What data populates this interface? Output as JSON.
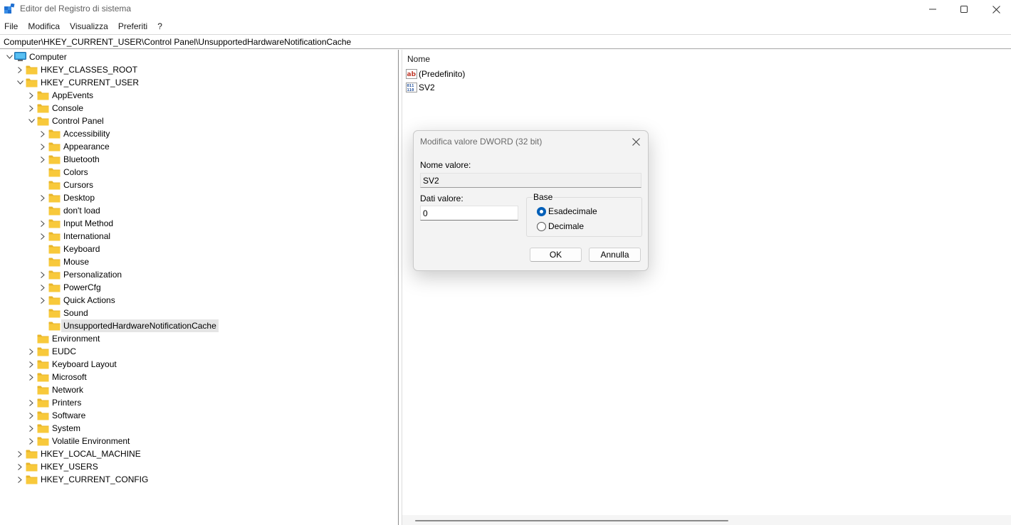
{
  "window": {
    "title": "Editor del Registro di sistema",
    "icon": "regedit-icon",
    "controls": [
      "minimize-icon",
      "maximize-icon",
      "close-icon"
    ]
  },
  "menu": {
    "items": [
      {
        "label": "File"
      },
      {
        "label": "Modifica"
      },
      {
        "label": "Visualizza"
      },
      {
        "label": "Preferiti"
      },
      {
        "label": "?"
      }
    ]
  },
  "address": {
    "path": "Computer\\HKEY_CURRENT_USER\\Control Panel\\UnsupportedHardwareNotificationCache"
  },
  "tree": {
    "items": [
      {
        "label": "Computer",
        "level": 0,
        "chevron": "down",
        "icon": "computer-icon"
      },
      {
        "label": "HKEY_CLASSES_ROOT",
        "level": 1,
        "chevron": "right"
      },
      {
        "label": "HKEY_CURRENT_USER",
        "level": 1,
        "chevron": "down"
      },
      {
        "label": "AppEvents",
        "level": 2,
        "chevron": "right"
      },
      {
        "label": "Console",
        "level": 2,
        "chevron": "right"
      },
      {
        "label": "Control Panel",
        "level": 2,
        "chevron": "down"
      },
      {
        "label": "Accessibility",
        "level": 3,
        "chevron": "right"
      },
      {
        "label": "Appearance",
        "level": 3,
        "chevron": "right"
      },
      {
        "label": "Bluetooth",
        "level": 3,
        "chevron": "right"
      },
      {
        "label": "Colors",
        "level": 3,
        "chevron": "none"
      },
      {
        "label": "Cursors",
        "level": 3,
        "chevron": "none"
      },
      {
        "label": "Desktop",
        "level": 3,
        "chevron": "right"
      },
      {
        "label": "don't load",
        "level": 3,
        "chevron": "none"
      },
      {
        "label": "Input Method",
        "level": 3,
        "chevron": "right"
      },
      {
        "label": "International",
        "level": 3,
        "chevron": "right"
      },
      {
        "label": "Keyboard",
        "level": 3,
        "chevron": "none"
      },
      {
        "label": "Mouse",
        "level": 3,
        "chevron": "none"
      },
      {
        "label": "Personalization",
        "level": 3,
        "chevron": "right"
      },
      {
        "label": "PowerCfg",
        "level": 3,
        "chevron": "right"
      },
      {
        "label": "Quick Actions",
        "level": 3,
        "chevron": "right"
      },
      {
        "label": "Sound",
        "level": 3,
        "chevron": "none"
      },
      {
        "label": "UnsupportedHardwareNotificationCache",
        "level": 3,
        "chevron": "none",
        "selected": true
      },
      {
        "label": "Environment",
        "level": 2,
        "chevron": "none"
      },
      {
        "label": "EUDC",
        "level": 2,
        "chevron": "right"
      },
      {
        "label": "Keyboard Layout",
        "level": 2,
        "chevron": "right"
      },
      {
        "label": "Microsoft",
        "level": 2,
        "chevron": "right"
      },
      {
        "label": "Network",
        "level": 2,
        "chevron": "none"
      },
      {
        "label": "Printers",
        "level": 2,
        "chevron": "right"
      },
      {
        "label": "Software",
        "level": 2,
        "chevron": "right"
      },
      {
        "label": "System",
        "level": 2,
        "chevron": "right"
      },
      {
        "label": "Volatile Environment",
        "level": 2,
        "chevron": "right"
      },
      {
        "label": "HKEY_LOCAL_MACHINE",
        "level": 1,
        "chevron": "right"
      },
      {
        "label": "HKEY_USERS",
        "level": 1,
        "chevron": "right"
      },
      {
        "label": "HKEY_CURRENT_CONFIG",
        "level": 1,
        "chevron": "right"
      }
    ]
  },
  "list": {
    "column_name": "Nome",
    "values": [
      {
        "name": "(Predefinito)",
        "icon": "string-value-icon"
      },
      {
        "name": "SV2",
        "icon": "binary-value-icon"
      }
    ]
  },
  "dialog": {
    "title": "Modifica valore DWORD (32 bit)",
    "name_label": "Nome valore:",
    "name_value": "SV2",
    "data_label": "Dati valore:",
    "data_value": "0",
    "base_label": "Base",
    "base_options": [
      {
        "label": "Esadecimale",
        "checked": true
      },
      {
        "label": "Decimale",
        "checked": false
      }
    ],
    "ok_label": "OK",
    "cancel_label": "Annulla"
  },
  "colors": {
    "folder_fill": "#f8c93b",
    "folder_tab": "#e8b52a",
    "accent": "#005fb8",
    "selection": "#e5e5e5"
  }
}
